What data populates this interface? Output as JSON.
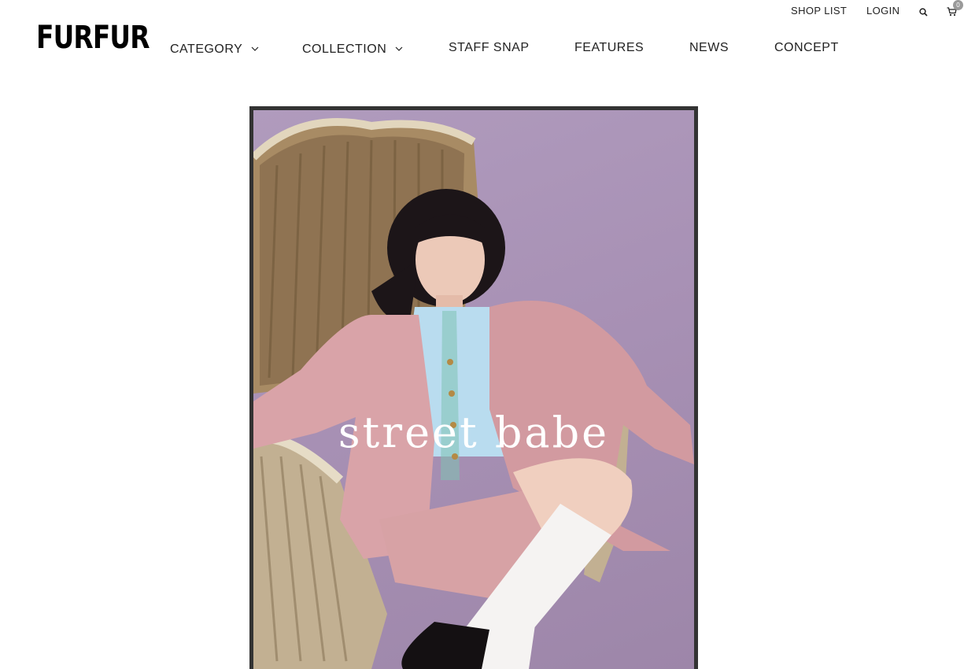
{
  "brand": {
    "logo_text": "FURFUR"
  },
  "utility": {
    "shop_list": "SHOP LIST",
    "login": "LOGIN",
    "search_icon": "search-icon",
    "cart_icon": "cart-icon",
    "cart_count": "0"
  },
  "nav": {
    "items": [
      {
        "label": "CATEGORY",
        "has_dropdown": true
      },
      {
        "label": "COLLECTION",
        "has_dropdown": true
      },
      {
        "label": "STAFF SNAP",
        "has_dropdown": false
      },
      {
        "label": "FEATURES",
        "has_dropdown": false
      },
      {
        "label": "NEWS",
        "has_dropdown": false
      },
      {
        "label": "CONCEPT",
        "has_dropdown": false
      }
    ]
  },
  "hero": {
    "title": "street babe",
    "colors": {
      "background": "#a891b5",
      "frame": "#333333",
      "coat": "#d9a3a8",
      "sweater": "#b9dcef",
      "chair": "#a88b64"
    }
  }
}
